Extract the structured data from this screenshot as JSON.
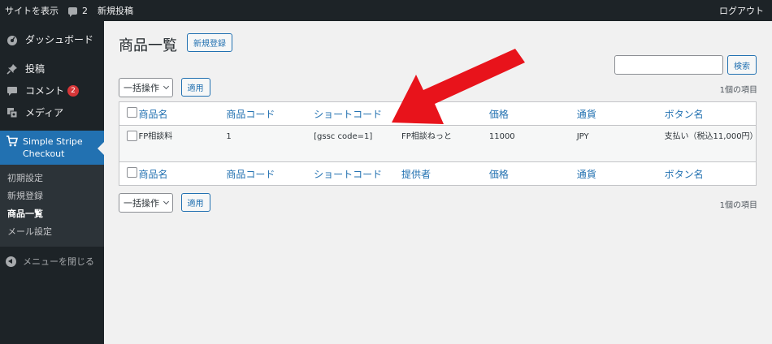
{
  "adminbar": {
    "site_label": "サイトを表示",
    "comments_count": "2",
    "new_post_label": "新規投稿",
    "logout_label": "ログアウト"
  },
  "sidebar": {
    "items": [
      {
        "label": "ダッシュボード",
        "icon": "dashboard-icon"
      },
      {
        "label": "投稿",
        "icon": "pin-icon"
      },
      {
        "label": "コメント",
        "icon": "comment-icon",
        "badge": "2"
      },
      {
        "label": "メディア",
        "icon": "media-icon"
      }
    ],
    "current": {
      "label": "Simple Stripe Checkout",
      "icon": "cart-icon"
    },
    "submenu": [
      "初期設定",
      "新規登録",
      "商品一覧",
      "メール設定"
    ],
    "collapse_label": "メニューを閉じる"
  },
  "page": {
    "title": "商品一覧",
    "add_new_label": "新規登録",
    "search_value": "",
    "search_button": "検索",
    "bulk_action_label": "一括操作",
    "apply_label": "適用",
    "item_count": "1個の項目"
  },
  "table": {
    "columns": [
      "商品名",
      "商品コード",
      "ショートコード",
      "提供者",
      "価格",
      "通貨",
      "ボタン名"
    ],
    "rows": [
      {
        "name": "FP相談料",
        "code": "1",
        "shortcode": "[gssc code=1]",
        "provider": "FP相談ねっと",
        "price": "11000",
        "currency": "JPY",
        "button": "支払い（税込11,000円）"
      }
    ]
  },
  "colors": {
    "adminbar_bg": "#1d2327",
    "accent": "#2271b1",
    "annotation_arrow": "#e8131b"
  }
}
